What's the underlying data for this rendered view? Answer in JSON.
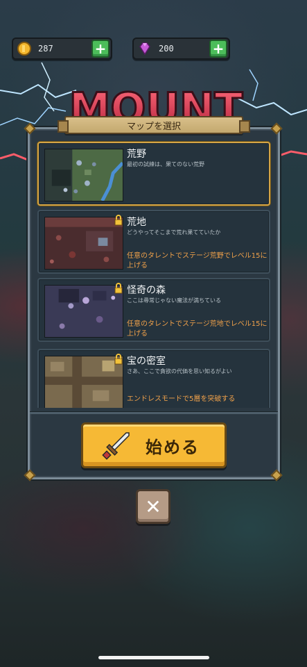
{
  "currency": {
    "coins": {
      "value": "287",
      "icon": "coin-icon",
      "color": "#f5b82e"
    },
    "gems": {
      "value": "200",
      "icon": "gem-icon",
      "color": "#c65bd8"
    },
    "add_symbol": "+"
  },
  "logo_text": "MOUNT",
  "panel": {
    "title": "マップを選択"
  },
  "maps": [
    {
      "name": "荒野",
      "description": "最初の試練は、果てのない荒野",
      "locked": false,
      "selected": true,
      "requirement": ""
    },
    {
      "name": "荒地",
      "description": "どうやってそこまで荒れ果てていたか",
      "locked": true,
      "selected": false,
      "requirement": "任意のタレントでステージ荒野でレベル15に上げる"
    },
    {
      "name": "怪奇の森",
      "description": "ここは尋常じゃない魔法が満ちている",
      "locked": true,
      "selected": false,
      "requirement": "任意のタレントでステージ荒地でレベル15に上げる"
    },
    {
      "name": "宝の密室",
      "description": "さあ、ここで貪欲の代価を思い知るがよい",
      "locked": true,
      "selected": false,
      "requirement": "エンドレスモードで5層を突破する"
    }
  ],
  "start_button": {
    "label": "始める",
    "icon": "sword-icon",
    "color": "#f6b935"
  },
  "close_button": {
    "symbol": "✕",
    "icon": "close-icon"
  },
  "colors": {
    "accent_gold": "#d4a547",
    "requirement_orange": "#f0a14a",
    "plus_green": "#4cbd5a"
  }
}
